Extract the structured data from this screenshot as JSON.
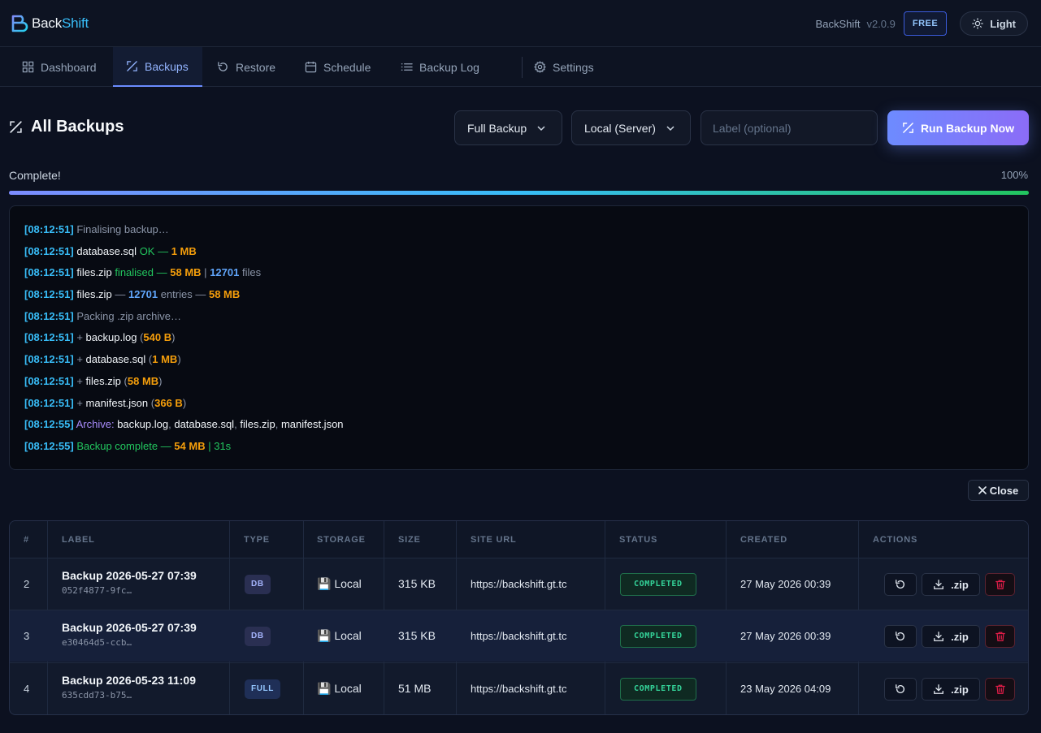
{
  "header": {
    "brand_prefix": "Back",
    "brand_suffix": "Shift",
    "app_name": "BackShift",
    "version": "v2.0.9",
    "plan_badge": "FREE",
    "theme_toggle": "Light"
  },
  "nav": {
    "tabs": [
      {
        "label": "Dashboard",
        "icon": "grid-icon"
      },
      {
        "label": "Backups",
        "icon": "backup-icon",
        "active": true
      },
      {
        "label": "Restore",
        "icon": "restore-icon"
      },
      {
        "label": "Schedule",
        "icon": "calendar-icon"
      },
      {
        "label": "Backup Log",
        "icon": "list-icon"
      },
      {
        "label": "Settings",
        "icon": "gear-icon"
      }
    ]
  },
  "section": {
    "title": "All Backups",
    "backup_type": "Full Backup",
    "storage": "Local (Server)",
    "label_placeholder": "Label (optional)",
    "run_button": "Run Backup Now"
  },
  "progress": {
    "status": "Complete!",
    "percent_label": "100%",
    "percent": 100
  },
  "log": {
    "close_label": "Close"
  },
  "table": {
    "headers": [
      "#",
      "LABEL",
      "TYPE",
      "STORAGE",
      "SIZE",
      "SITE URL",
      "STATUS",
      "CREATED",
      "ACTIONS"
    ],
    "zip_label": ".zip",
    "rows": [
      {
        "num": "2",
        "label": "Backup 2026-05-27 07:39",
        "id": "052f4877-9fc…",
        "type": "DB",
        "storage": "💾 Local",
        "size": "315 KB",
        "url": "https://backshift.gt.tc",
        "status": "COMPLETED",
        "created": "27 May 2026 00:39"
      },
      {
        "num": "3",
        "label": "Backup 2026-05-27 07:39",
        "id": "e30464d5-ccb…",
        "type": "DB",
        "storage": "💾 Local",
        "size": "315 KB",
        "url": "https://backshift.gt.tc",
        "status": "COMPLETED",
        "created": "27 May 2026 00:39"
      },
      {
        "num": "4",
        "label": "Backup 2026-05-23 11:09",
        "id": "635cdd73-b75…",
        "type": "FULL",
        "storage": "💾 Local",
        "size": "51 MB",
        "url": "https://backshift.gt.tc",
        "status": "COMPLETED",
        "created": "23 May 2026 04:09"
      }
    ]
  },
  "colors": {
    "accent": "#6d8bff",
    "success": "#22c55e",
    "timestamp": "#38bdf8",
    "size_highlight": "#f59e0b",
    "danger": "#e11d48"
  }
}
